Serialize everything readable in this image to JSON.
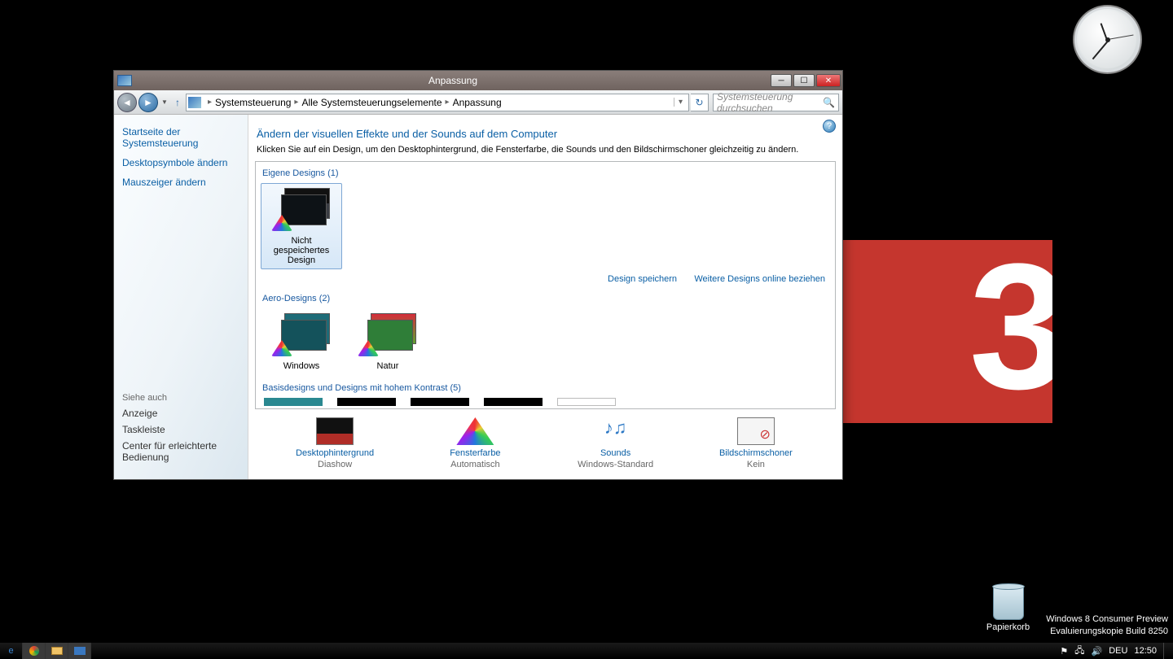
{
  "desktop": {
    "recyclebin_label": "Papierkorb",
    "watermark_line1": "Windows 8 Consumer Preview",
    "watermark_line2": "Evaluierungskopie Build 8250"
  },
  "taskbar": {
    "lang": "DEU",
    "time": "12:50"
  },
  "window": {
    "title": "Anpassung",
    "breadcrumb": {
      "p1": "Systemsteuerung",
      "p2": "Alle Systemsteuerungselemente",
      "p3": "Anpassung"
    },
    "search_placeholder": "Systemsteuerung durchsuchen",
    "sidebar": {
      "link1": "Startseite der Systemsteuerung",
      "link2": "Desktopsymbole ändern",
      "link3": "Mauszeiger ändern",
      "seealso_hdr": "Siehe auch",
      "sa1": "Anzeige",
      "sa2": "Taskleiste",
      "sa3": "Center für erleichterte Bedienung"
    },
    "main": {
      "heading": "Ändern der visuellen Effekte und der Sounds auf dem Computer",
      "sub": "Klicken Sie auf ein Design, um den Desktophintergrund, die Fensterfarbe, die Sounds und den Bildschirmschoner gleichzeitig zu ändern.",
      "group1": "Eigene Designs (1)",
      "theme1": "Nicht gespeichertes Design",
      "link_save": "Design speichern",
      "link_more": "Weitere Designs online beziehen",
      "group2": "Aero-Designs (2)",
      "theme_win": "Windows",
      "theme_nat": "Natur",
      "group3": "Basisdesigns und Designs mit hohem Kontrast (5)"
    },
    "bottom": {
      "bg_label": "Desktophintergrund",
      "bg_value": "Diashow",
      "fc_label": "Fensterfarbe",
      "fc_value": "Automatisch",
      "sd_label": "Sounds",
      "sd_value": "Windows-Standard",
      "ss_label": "Bildschirmschoner",
      "ss_value": "Kein"
    }
  }
}
